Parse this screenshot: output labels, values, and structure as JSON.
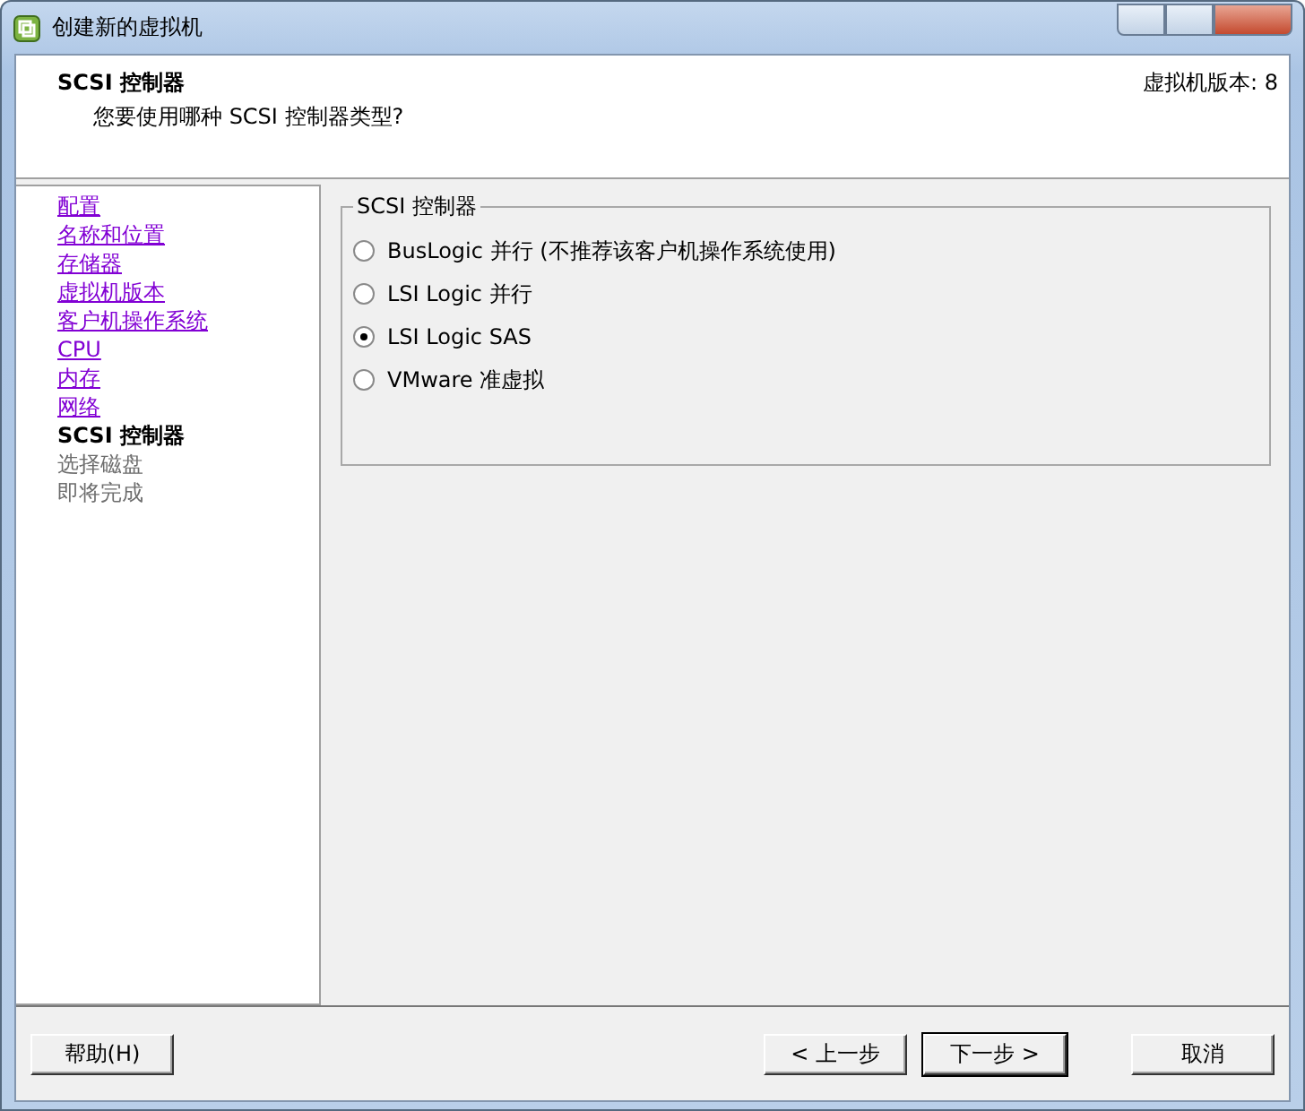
{
  "window": {
    "title": "创建新的虚拟机"
  },
  "header": {
    "title": "SCSI 控制器",
    "subtitle": "您要使用哪种 SCSI 控制器类型?",
    "version": "虚拟机版本: 8"
  },
  "steps": [
    {
      "label": "配置",
      "done": true,
      "current": false
    },
    {
      "label": "名称和位置",
      "done": true,
      "current": false
    },
    {
      "label": "存储器",
      "done": true,
      "current": false
    },
    {
      "label": "虚拟机版本",
      "done": true,
      "current": false
    },
    {
      "label": "客户机操作系统",
      "done": true,
      "current": false
    },
    {
      "label": "CPU",
      "done": true,
      "current": false
    },
    {
      "label": "内存",
      "done": true,
      "current": false
    },
    {
      "label": "网络",
      "done": true,
      "current": false
    },
    {
      "label": "SCSI 控制器",
      "done": false,
      "current": true
    },
    {
      "label": "选择磁盘",
      "done": false,
      "current": false
    },
    {
      "label": "即将完成",
      "done": false,
      "current": false
    }
  ],
  "group": {
    "title": "SCSI 控制器",
    "options": [
      {
        "label": "BusLogic 并行 (不推荐该客户机操作系统使用)",
        "selected": false
      },
      {
        "label": "LSI Logic 并行",
        "selected": false
      },
      {
        "label": "LSI Logic SAS",
        "selected": true
      },
      {
        "label": "VMware 准虚拟",
        "selected": false
      }
    ]
  },
  "buttons": {
    "help": "帮助(H)",
    "nav": [
      {
        "label": "< 上一步",
        "default": false
      },
      {
        "label": "下一步 >",
        "default": true
      },
      {
        "label": "取消",
        "default": false
      }
    ]
  }
}
